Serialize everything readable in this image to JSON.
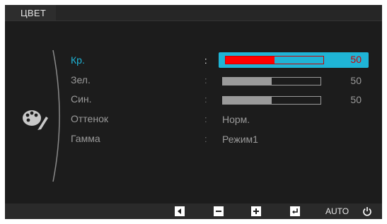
{
  "osd": {
    "title": "ЦВЕТ"
  },
  "menu": {
    "items": [
      {
        "label": "Кр.",
        "separator": ":",
        "control": "bar",
        "value": "50",
        "level": 0.5,
        "selected": true
      },
      {
        "label": "Зел.",
        "separator": ":",
        "control": "bar",
        "value": "50",
        "level": 0.5,
        "selected": false
      },
      {
        "label": "Син.",
        "separator": ":",
        "control": "bar",
        "value": "50",
        "level": 0.5,
        "selected": false
      },
      {
        "label": "Оттенок",
        "separator": ":",
        "control": "text",
        "value": "Норм.",
        "selected": false
      },
      {
        "label": "Гамма",
        "separator": ":",
        "control": "text",
        "value": "Режим1",
        "selected": false
      }
    ]
  },
  "bottom_bar": {
    "auto_label": "AUTO",
    "buttons": [
      "left-arrow-icon",
      "minus-icon",
      "plus-icon",
      "enter-icon",
      "auto",
      "power-icon"
    ]
  },
  "colors": {
    "accent": "#1fb4d6",
    "red_bar": "#ff0000",
    "red_text": "#d10000",
    "background": "#1c1c1c"
  }
}
